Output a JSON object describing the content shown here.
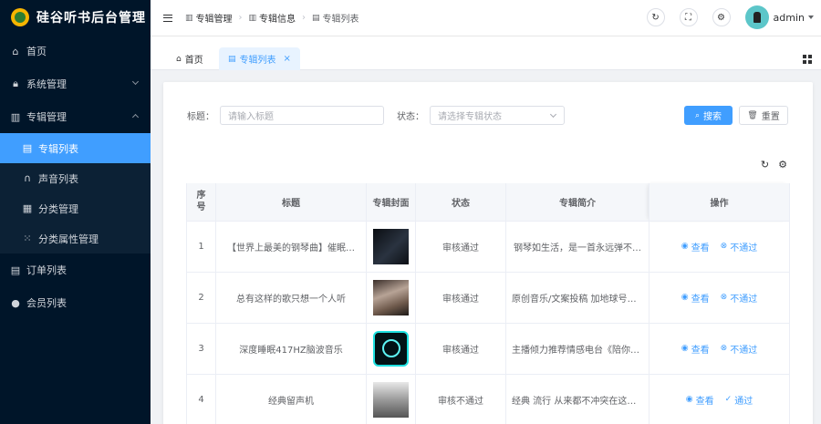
{
  "app": {
    "title": "硅谷听书后台管理"
  },
  "sidebar": {
    "items": [
      {
        "label": "首页",
        "icon": "home-icon"
      },
      {
        "label": "系统管理",
        "icon": "lock-icon"
      },
      {
        "label": "专辑管理",
        "icon": "album-icon"
      },
      {
        "label": "订单列表",
        "icon": "order-icon"
      },
      {
        "label": "会员列表",
        "icon": "user-icon"
      }
    ],
    "album_sub": [
      {
        "label": "专辑列表",
        "active": true
      },
      {
        "label": "声音列表"
      },
      {
        "label": "分类管理"
      },
      {
        "label": "分类属性管理"
      }
    ]
  },
  "header": {
    "breadcrumb": [
      "专辑管理",
      "专辑信息",
      "专辑列表"
    ],
    "username": "admin"
  },
  "tabs": [
    {
      "label": "首页"
    },
    {
      "label": "专辑列表",
      "active": true
    }
  ],
  "search": {
    "title_label": "标题：",
    "title_placeholder": "请输入标题",
    "status_label": "状态：",
    "status_placeholder": "请选择专辑状态",
    "search_btn": "搜索",
    "reset_btn": "重置"
  },
  "table": {
    "headers": {
      "index": "序号",
      "title": "标题",
      "cover": "专辑封面",
      "status": "状态",
      "intro": "专辑简介",
      "ops": "操作"
    },
    "rows": [
      {
        "index": "1",
        "title": "【世界上最美的钢琴曲】催眠…",
        "status": "审核通过",
        "intro": "钢琴如生活，是一首永远弹不…",
        "op1": "查看",
        "op2": "不通过"
      },
      {
        "index": "2",
        "title": "总有这样的歌只想一个人听",
        "status": "审核通过",
        "intro": "原创音乐/文案投稿 加地球号：S…",
        "op1": "查看",
        "op2": "不通过"
      },
      {
        "index": "3",
        "title": "深度睡眠417HZ脑波音乐",
        "status": "审核通过",
        "intro": "主播倾力推荐情感电台《陪你的一…",
        "op1": "查看",
        "op2": "不通过"
      },
      {
        "index": "4",
        "title": "经典留声机",
        "status": "审核不通过",
        "intro": "经典 流行 从来都不冲突在这里，…",
        "op1": "查看",
        "op2": "通过"
      }
    ]
  },
  "colors": {
    "primary": "#409eff",
    "sidebar": "#001529"
  }
}
